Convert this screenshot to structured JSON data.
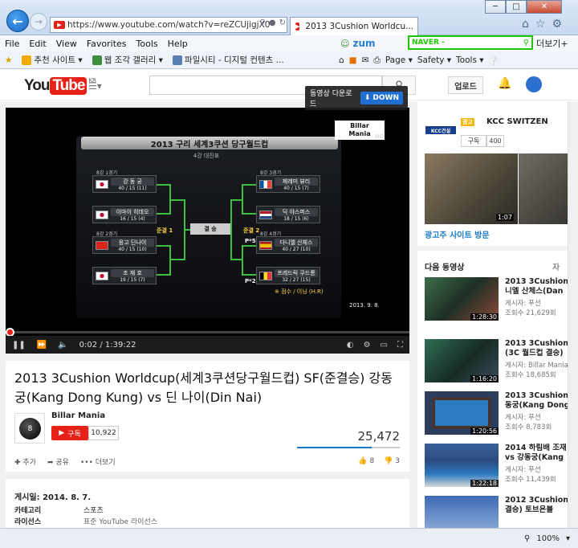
{
  "browser": {
    "url": "https://www.youtube.com/watch?v=reZCUjigjX0",
    "tab_title": "2013 3Cushion Worldcu...",
    "menu": [
      "File",
      "Edit",
      "View",
      "Favorites",
      "Tools",
      "Help"
    ],
    "zum": "zum",
    "naver_label": "NAVER -",
    "more_tools": "더보기+",
    "favorites": [
      "추천 사이트 ▾",
      "웹 조각 갤러리 ▾",
      "파일시티 - 디지털 컨텐츠 ..."
    ],
    "cmd": [
      "Page ▾",
      "Safety ▾",
      "Tools ▾"
    ],
    "zoom": "100%"
  },
  "youtube": {
    "logo_you": "You",
    "logo_tube": "Tube",
    "logo_region": "KR",
    "upload": "업로드",
    "download_popup_label": "동영상 다운로드",
    "download_button": "DOWN"
  },
  "player": {
    "board_title": "2013 구리 세계3쿠션 당구월드컵",
    "board_subtitle": "4강 대진표",
    "final_label": "결 승",
    "semi1": "준결 1",
    "semi2": "준결 2",
    "left_players": [
      {
        "round": "8강 1경기",
        "name": "강 동 궁",
        "score": "40 / 15 (11)"
      },
      {
        "round": "",
        "name": "이마이 히데오",
        "score": "16 / 15 (4)"
      },
      {
        "round": "8강 2경기",
        "name": "응고 딘나이",
        "score": "40 / 15 (10)"
      },
      {
        "round": "",
        "name": "조 재 호",
        "score": "19 / 15 (7)"
      }
    ],
    "right_players": [
      {
        "round": "8강 3경기",
        "name": "제레미 뷰리",
        "score": "40 / 15 (7)"
      },
      {
        "round": "",
        "name": "딕 야스퍼스",
        "score": "18 / 15 (6)"
      },
      {
        "round": "8강 4경기",
        "name": "다니엘 산체스",
        "score": "40 / 27 (10)"
      },
      {
        "round": "",
        "name": "프레드릭 쿠드롱",
        "score": "32 / 27 (15)"
      }
    ],
    "ps_label": "P*5",
    "p2_label": "P*2",
    "points_note": "※ 점수 / 이닝 (H.R)",
    "date": "2013. 9. 8.",
    "brand_line1": "Billar",
    "brand_line2": "Mania",
    "hd": "HD",
    "current_time": "0:02",
    "duration": "1:39:22",
    "progress_fraction": 0.0003
  },
  "video": {
    "title": "2013 3Cushion Worldcup(세계3쿠션당구월드컵) SF(준결승) 강동궁(Kang Dong Kung) vs 딘 나이(Din Nai)",
    "channel": "Billar Mania",
    "subscribe": "구독",
    "subscribers": "10,922",
    "views": "25,472",
    "add": "추가",
    "share": "공유",
    "more": "더보기",
    "likes": "8",
    "dislikes": "3",
    "like_ratio": 0.73,
    "published": "게시일: 2014. 8. 7.",
    "category_label": "카테고리",
    "category_value": "스포츠",
    "license_label": "라이선스",
    "license_value": "표준 YouTube 라이선스"
  },
  "sidebar": {
    "ad_badge": "광고",
    "ad_channel": "KCC SWITZEN",
    "kcc_logo": "KCC건설",
    "ad_subscribe": "구독",
    "ad_subscribers": "400",
    "ad_duration": "1:07",
    "ad_link": "광고주 사이트 방문",
    "up_next": "다음 동영상",
    "autoplay": "자",
    "videos": [
      {
        "title1": "2013 3Cushion",
        "title2": "니엘 산체스(Dan",
        "channel": "게시자: 푸션",
        "views": "조회수 21,629회",
        "duration": "1:28:30"
      },
      {
        "title1": "2013 3Cushion",
        "title2": "(3C 월드컵 결승)",
        "channel": "게시자: Billar Mania",
        "views": "조회수 18,685회",
        "duration": "1:16:20"
      },
      {
        "title1": "2013 3Cushion",
        "title2": "동궁(Kang Dong",
        "channel": "게시자: 푸션",
        "views": "조회수 8,783회",
        "duration": "1:20:56"
      },
      {
        "title1": "2014 하림배 조재",
        "title2": "vs 강동궁(Kang",
        "channel": "게시자: 푸션",
        "views": "조회수 11,439회",
        "duration": "1:22:18"
      },
      {
        "title1": "2012 3Cushion",
        "title2": "결승) 토브욘블",
        "channel": "",
        "views": "",
        "duration": ""
      }
    ]
  }
}
